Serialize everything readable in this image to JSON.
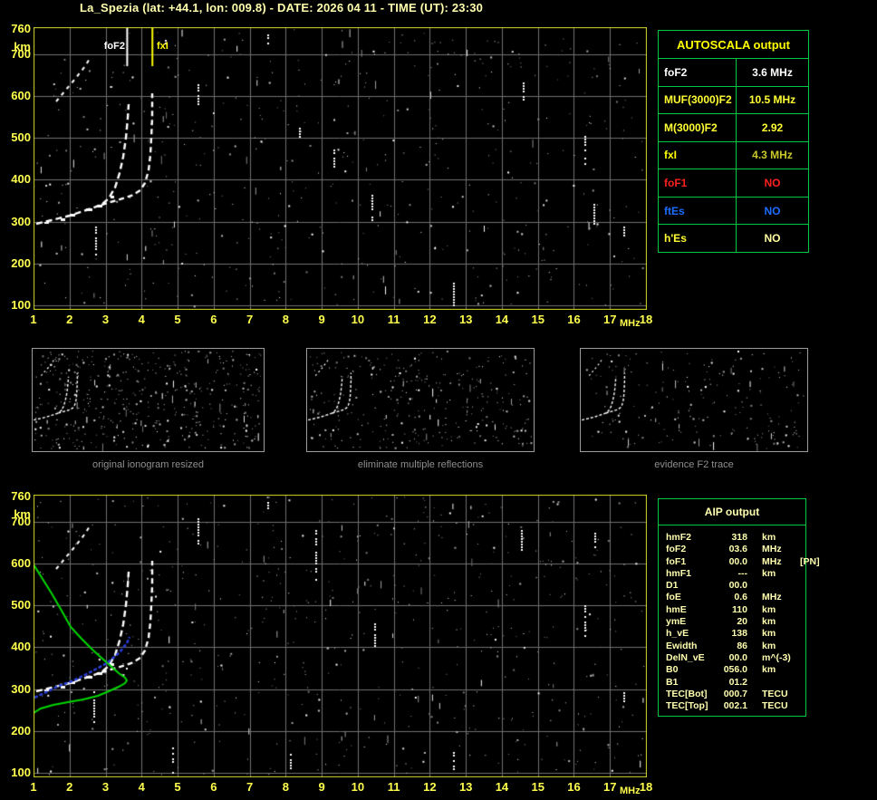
{
  "title": "La_Spezia (lat: +44.1, lon: 009.8) - DATE: 2026 04 11 - TIME (UT): 23:30",
  "axes": {
    "y_unit": "km",
    "x_unit": "MHz",
    "y_ticks": [
      760,
      700,
      600,
      500,
      400,
      300,
      200,
      100
    ],
    "x_ticks": [
      1,
      2,
      3,
      4,
      5,
      6,
      7,
      8,
      9,
      10,
      11,
      12,
      13,
      14,
      15,
      16,
      17,
      18
    ],
    "x_range_mhz": [
      1,
      18
    ]
  },
  "top_ionogram": {
    "markers": {
      "foF2": {
        "label": "foF2",
        "freq_mhz": 3.6,
        "color": "#ffffff"
      },
      "fxI": {
        "label": "fxI",
        "freq_mhz": 4.3,
        "color": "#ffff00"
      }
    }
  },
  "panels": [
    {
      "caption": "original ionogram resized"
    },
    {
      "caption": "eliminate multiple reflections"
    },
    {
      "caption": "evidence F2 trace"
    }
  ],
  "autoscala": {
    "header": "AUTOSCALA output",
    "rows": [
      {
        "label": "foF2",
        "value": "3.6 MHz",
        "label_color": "#ffffff",
        "value_color": "#ffffff"
      },
      {
        "label": "MUF(3000)F2",
        "value": "10.5 MHz",
        "label_color": "#ffff33",
        "value_color": "#ffff33"
      },
      {
        "label": "M(3000)F2",
        "value": "2.92",
        "label_color": "#ffff33",
        "value_color": "#ffff33"
      },
      {
        "label": "fxI",
        "value": "4.3 MHz",
        "label_color": "#ffff00",
        "value_color": "#c9c929"
      },
      {
        "label": "foF1",
        "value": "NO",
        "label_color": "#ff2020",
        "value_color": "#ff2020"
      },
      {
        "label": "ftEs",
        "value": "NO",
        "label_color": "#1c6dff",
        "value_color": "#1c6dff"
      },
      {
        "label": "h'Es",
        "value": "NO",
        "label_color": "#ffff33",
        "value_color": "#ffffa0"
      }
    ]
  },
  "aip": {
    "header": "AIP output",
    "rows": [
      {
        "name": "hmF2",
        "value": "318",
        "unit": "km",
        "extra": ""
      },
      {
        "name": "foF2",
        "value": "03.6",
        "unit": "MHz",
        "extra": ""
      },
      {
        "name": "foF1",
        "value": "00.0",
        "unit": "MHz",
        "extra": "[PN]"
      },
      {
        "name": "hmF1",
        "value": "---",
        "unit": "km",
        "extra": ""
      },
      {
        "name": "D1",
        "value": "00.0",
        "unit": "",
        "extra": ""
      },
      {
        "name": "foE",
        "value": "0.6",
        "unit": "MHz",
        "extra": ""
      },
      {
        "name": "hmE",
        "value": "110",
        "unit": "km",
        "extra": ""
      },
      {
        "name": "ymE",
        "value": "20",
        "unit": "km",
        "extra": ""
      },
      {
        "name": "h_vE",
        "value": "138",
        "unit": "km",
        "extra": ""
      },
      {
        "name": "Ewidth",
        "value": "86",
        "unit": "km",
        "extra": ""
      },
      {
        "name": "DelN_vE",
        "value": "00.0",
        "unit": "m^(-3)",
        "extra": ""
      },
      {
        "name": "B0",
        "value": "056.0",
        "unit": "km",
        "extra": ""
      },
      {
        "name": "B1",
        "value": "01.2",
        "unit": "",
        "extra": ""
      },
      {
        "name": "TEC[Bot]",
        "value": "000.7",
        "unit": "TECU",
        "extra": ""
      },
      {
        "name": "TEC[Top]",
        "value": "002.1",
        "unit": "TECU",
        "extra": ""
      }
    ]
  },
  "colors": {
    "plot_border": "#d6d62a",
    "grid": "#707070",
    "trace": "#ffffff",
    "profile_green": "#00d800",
    "fitted_trace_blue": "#2b3fd8",
    "table_border_green": "#00c846",
    "axis_label_yellow": "#ffff4d",
    "title_yellow": "#ffffae",
    "panel_border_gray": "#9c9c9c",
    "caption_gray": "#8f8f8f",
    "background": "#000000"
  }
}
